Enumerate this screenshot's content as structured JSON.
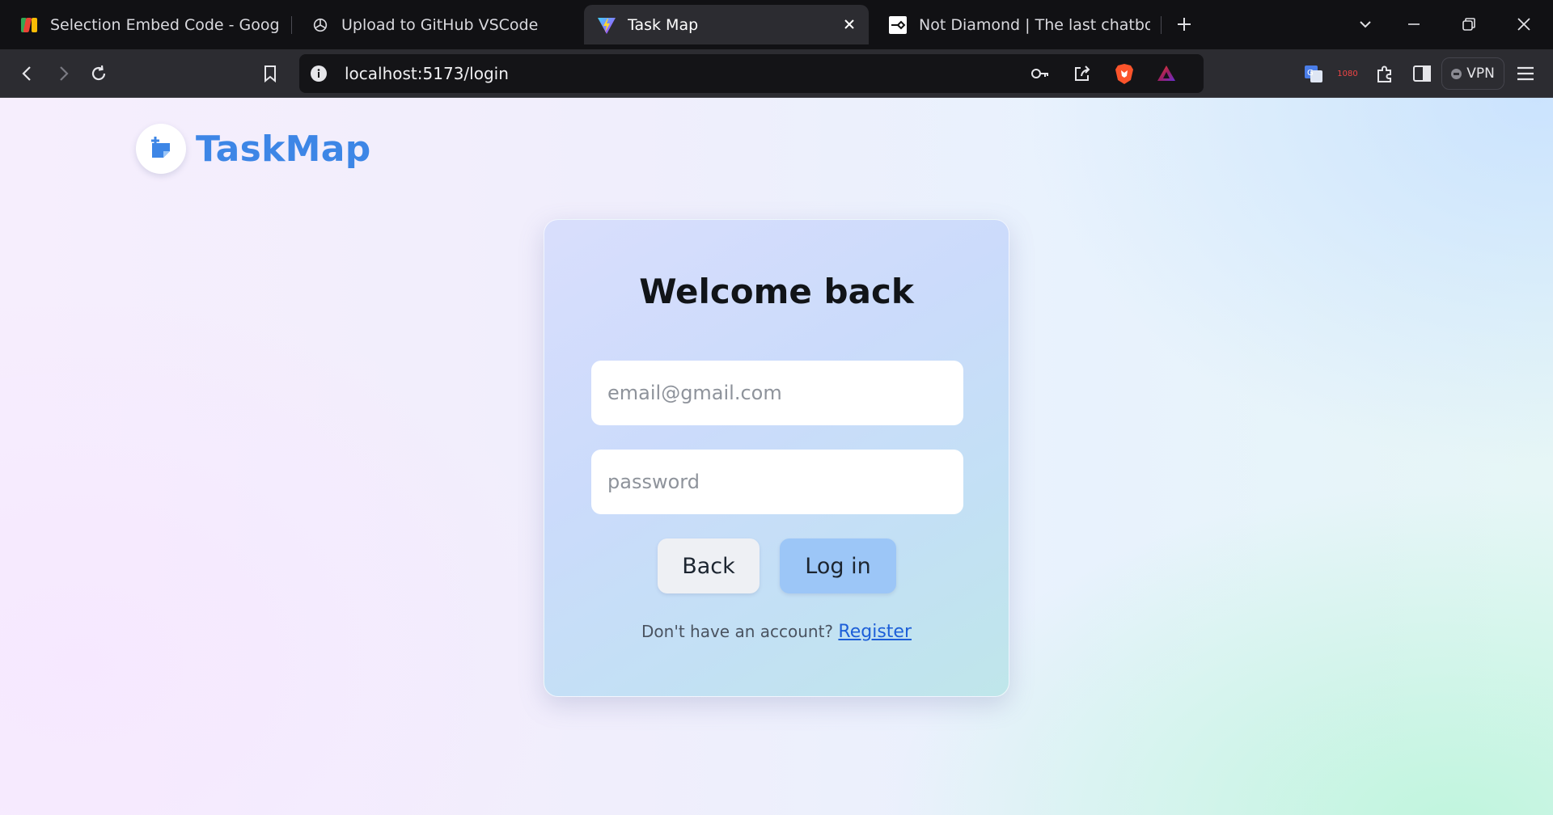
{
  "browser": {
    "tabs": [
      {
        "title": "Selection Embed Code - Google For",
        "icon": "google-forms-icon",
        "active": false
      },
      {
        "title": "Upload to GitHub VSCode",
        "icon": "chatgpt-icon",
        "active": false
      },
      {
        "title": "Task Map",
        "icon": "vite-icon",
        "active": true
      },
      {
        "title": "Not Diamond | The last chatbot you",
        "icon": "notdiamond-icon",
        "active": false
      }
    ],
    "address": "localhost:5173/login",
    "extension_badge": "1080",
    "vpn_label": "VPN"
  },
  "app": {
    "brand": "TaskMap",
    "brand_color": "#3d86e6"
  },
  "login": {
    "title": "Welcome back",
    "email_placeholder": "email@gmail.com",
    "password_placeholder": "password",
    "back_label": "Back",
    "login_label": "Log in",
    "register_prompt": "Don't have an account?",
    "register_link": "Register"
  }
}
